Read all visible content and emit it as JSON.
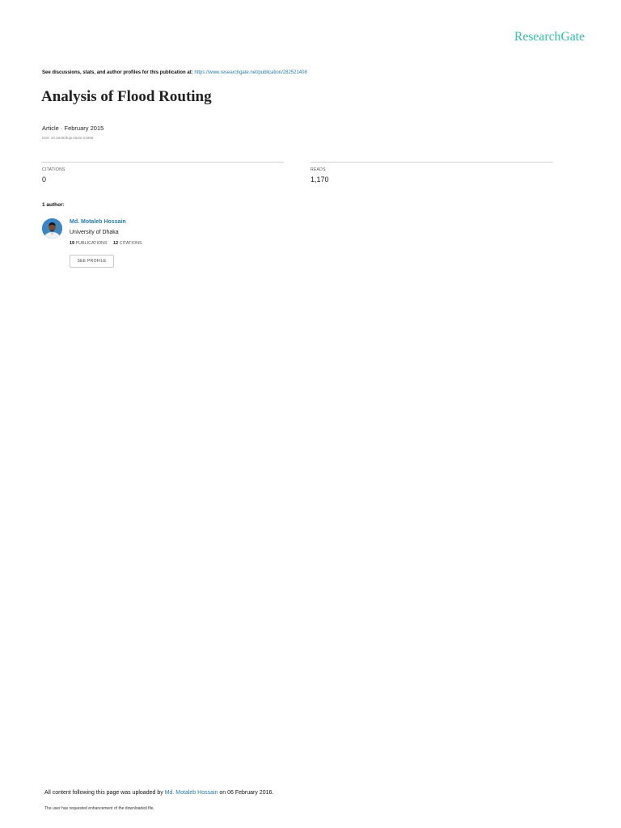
{
  "brand": {
    "logo_text": "ResearchGate",
    "accent_color": "#2fbfa8",
    "link_color": "#2a7aa3"
  },
  "header": {
    "discussion_prefix": "See discussions, stats, and author profiles for this publication at:",
    "publication_url": "https://www.researchgate.net/publication/282521408"
  },
  "publication": {
    "title": "Analysis of Flood Routing",
    "meta": "Article · February 2015",
    "doi": "DOI: 10.3329/dujs.v62i2.21968"
  },
  "stats": {
    "citations_label": "CITATIONS",
    "citations_value": "0",
    "reads_label": "READS",
    "reads_value": "1,170"
  },
  "authors": {
    "heading": "1 author:",
    "list": [
      {
        "name": "Md. Motaleb Hossain",
        "institution": "University of Dhaka",
        "publications_count": "19",
        "publications_label": "PUBLICATIONS",
        "citations_count": "12",
        "citations_label": "CITATIONS",
        "avatar_icon": "person-photo-icon",
        "see_profile_label": "SEE PROFILE"
      }
    ]
  },
  "footer": {
    "upload_prefix": "All content following this page was uploaded by",
    "uploader_name": "Md. Motaleb Hossain",
    "upload_suffix": "on 06 February 2016.",
    "request_note": "The user has requested enhancement of the downloaded file."
  }
}
